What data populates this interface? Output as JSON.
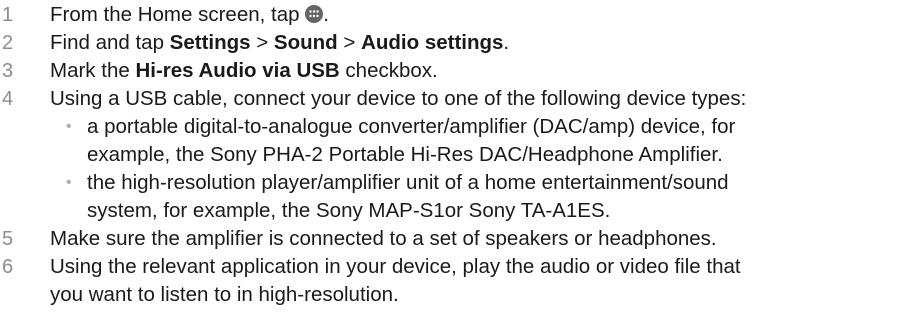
{
  "steps": [
    {
      "num": "1",
      "text_before": "From the Home screen, tap ",
      "text_after": ".",
      "icon": "apps-grid-icon"
    },
    {
      "num": "2",
      "text_before": "Find and tap ",
      "settings": "Settings",
      "sep1": " > ",
      "sound": "Sound",
      "sep2": " > ",
      "audio_settings": "Audio settings",
      "text_after": "."
    },
    {
      "num": "3",
      "text_before": "Mark the ",
      "bold": "Hi-res Audio via USB",
      "text_after": " checkbox."
    },
    {
      "num": "4",
      "text": "Using a USB cable, connect your device to one of the following device types:",
      "bullets": [
        {
          "line1": "a portable digital-to-analogue converter/amplifier (DAC/amp) device, for",
          "line2": "example, the Sony PHA-2 Portable Hi-Res DAC/Headphone Amplifier."
        },
        {
          "line1": "the high-resolution player/amplifier unit of a home entertainment/sound",
          "line2": "system, for example, the Sony MAP-S1or Sony TA-A1ES."
        }
      ],
      "bullet_glyph": "•"
    },
    {
      "num": "5",
      "text": "Make sure the amplifier is connected to a set of speakers or headphones."
    },
    {
      "num": "6",
      "line1": "Using the relevant application in your device, play the audio or video file that",
      "line2": "you want to listen to in high-resolution."
    }
  ]
}
